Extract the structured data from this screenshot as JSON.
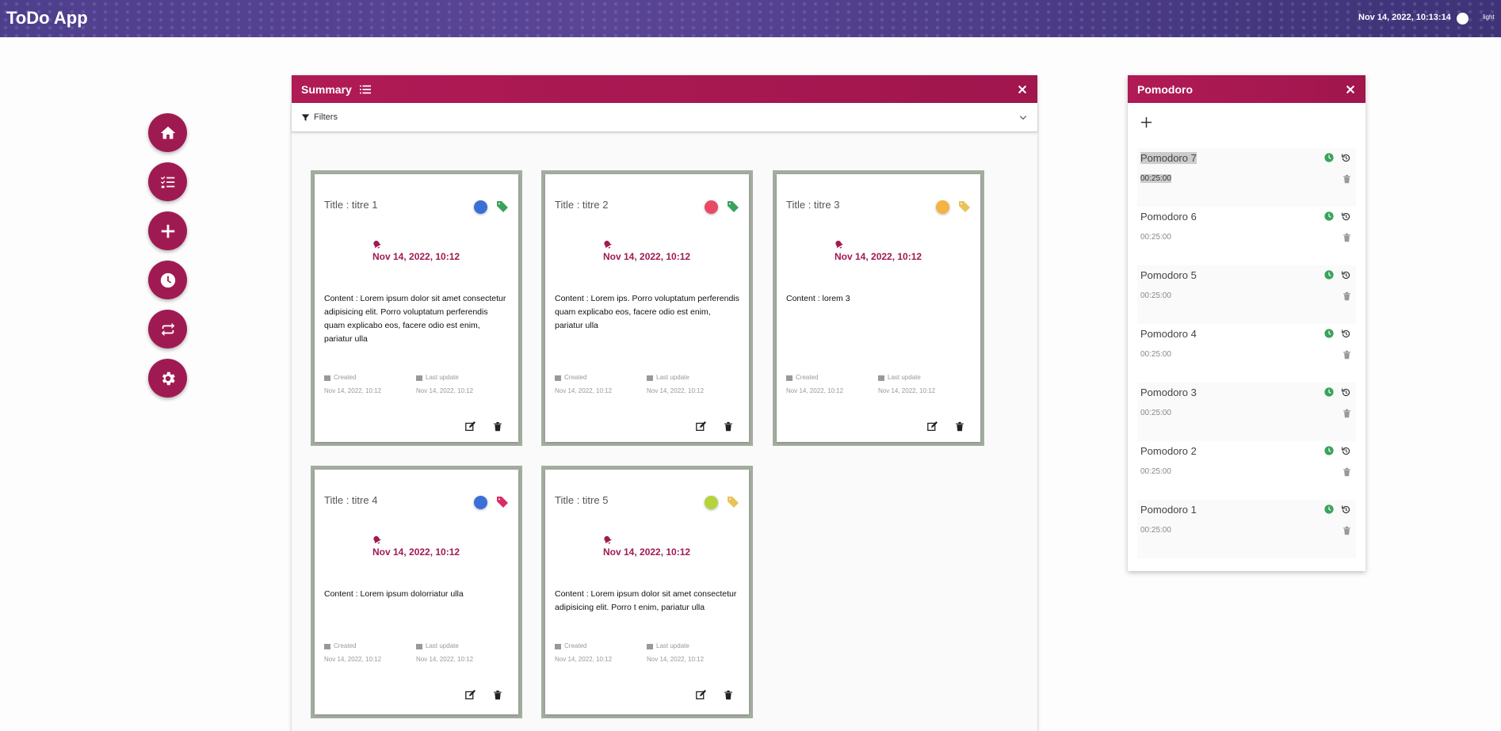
{
  "header": {
    "app_title": "ToDo App",
    "clock": "Nov 14, 2022, 10:13:14",
    "theme_label": "light"
  },
  "summary": {
    "title": "Summary",
    "filters_label": "Filters"
  },
  "labels": {
    "created": "Created",
    "last_update": "Last update"
  },
  "colors": {
    "accent": "#a01a52",
    "topbar": "#4e3f8c",
    "card_border": "#a3ad9f"
  },
  "cards": [
    {
      "title": "Title : titre 1",
      "dot_color": "#3b6fd8",
      "tag_color": "#3aa35b",
      "date": "Nov 14, 2022, 10:12",
      "content": "Content : Lorem ipsum dolor sit amet consectetur adipisicing elit. Porro voluptatum perferendis quam explicabo eos, facere odio est enim, pariatur ulla",
      "created": "Nov 14, 2022, 10:12",
      "updated": "Nov 14, 2022, 10:12"
    },
    {
      "title": "Title : titre 2",
      "dot_color": "#e84a64",
      "tag_color": "#3aa35b",
      "date": "Nov 14, 2022, 10:12",
      "content": "Content : Lorem ips. Porro voluptatum perferendis quam explicabo eos, facere odio est enim, pariatur ulla",
      "created": "Nov 14, 2022, 10:12",
      "updated": "Nov 14, 2022, 10:12"
    },
    {
      "title": "Title : titre 3",
      "dot_color": "#f5b342",
      "tag_color": "#e8c25a",
      "date": "Nov 14, 2022, 10:12",
      "content": "Content : lorem 3",
      "created": "Nov 14, 2022, 10:12",
      "updated": "Nov 14, 2022, 10:12"
    },
    {
      "title": "Title : titre 4",
      "dot_color": "#3b6fd8",
      "tag_color": "#d82c68",
      "date": "Nov 14, 2022, 10:12",
      "content": "Content : Lorem ipsum dolorriatur ulla",
      "created": "Nov 14, 2022, 10:12",
      "updated": "Nov 14, 2022, 10:12"
    },
    {
      "title": "Title : titre 5",
      "dot_color": "#b5d33a",
      "tag_color": "#e8c25a",
      "date": "Nov 14, 2022, 10:12",
      "content": "Content : Lorem ipsum dolor sit amet consectetur adipisicing elit. Porro t enim, pariatur ulla",
      "created": "Nov 14, 2022, 10:12",
      "updated": "Nov 14, 2022, 10:12"
    }
  ],
  "pomodoro": {
    "title": "Pomodoro",
    "items": [
      {
        "name": "Pomodoro 7",
        "time": "00:25:00"
      },
      {
        "name": "Pomodoro 6",
        "time": "00:25:00"
      },
      {
        "name": "Pomodoro 5",
        "time": "00:25:00"
      },
      {
        "name": "Pomodoro 4",
        "time": "00:25:00"
      },
      {
        "name": "Pomodoro 3",
        "time": "00:25:00"
      },
      {
        "name": "Pomodoro 2",
        "time": "00:25:00"
      },
      {
        "name": "Pomodoro 1",
        "time": "00:25:00"
      }
    ]
  }
}
